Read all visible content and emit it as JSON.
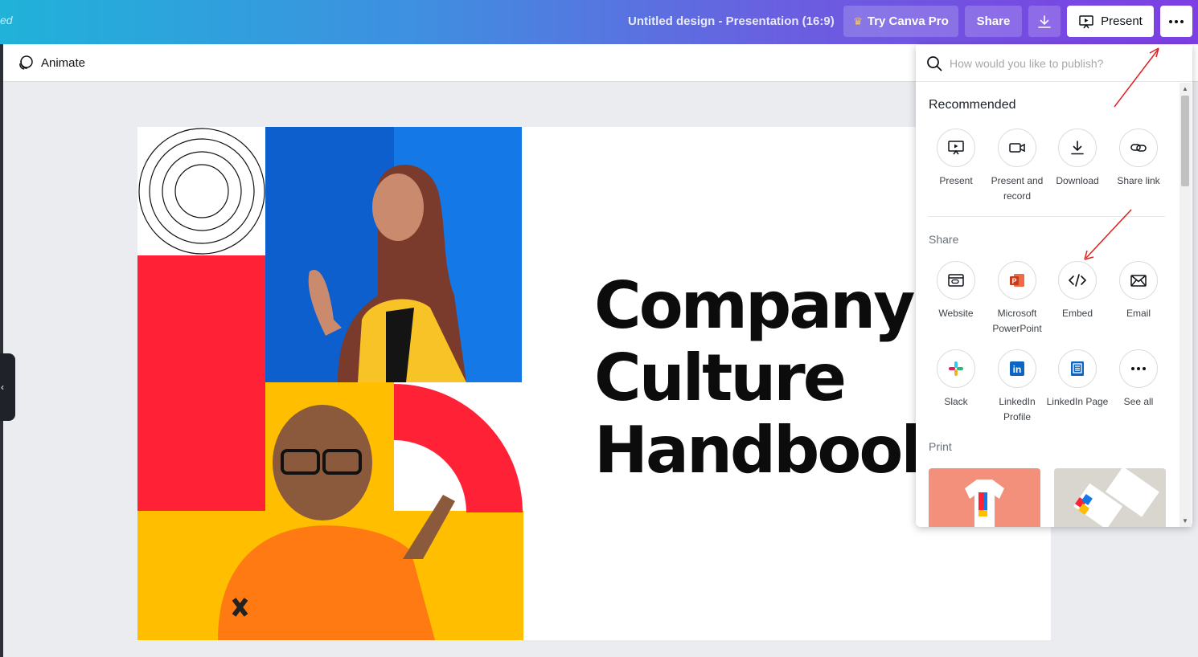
{
  "topbar": {
    "saved_fragment": "ed",
    "doc_title": "Untitled design - Presentation (16:9)",
    "try_pro_label": "Try Canva Pro",
    "share_label": "Share",
    "present_label": "Present",
    "download_icon": "download-icon",
    "more_icon": "more-horizontal-icon"
  },
  "toolbar": {
    "animate_label": "Animate"
  },
  "slide": {
    "title_lines": [
      "Company",
      "Culture",
      "Handbook"
    ]
  },
  "publish_panel": {
    "search_placeholder": "How would you like to publish?",
    "recommended_title": "Recommended",
    "recommended": [
      {
        "label": "Present",
        "icon": "present-icon"
      },
      {
        "label": "Present and record",
        "icon": "record-video-icon"
      },
      {
        "label": "Download",
        "icon": "download-icon"
      },
      {
        "label": "Share link",
        "icon": "link-icon"
      }
    ],
    "share_title": "Share",
    "share": [
      {
        "label": "Website",
        "icon": "website-icon"
      },
      {
        "label": "Microsoft PowerPoint",
        "icon": "powerpoint-icon"
      },
      {
        "label": "Embed",
        "icon": "embed-code-icon"
      },
      {
        "label": "Email",
        "icon": "email-icon"
      },
      {
        "label": "Slack",
        "icon": "slack-icon"
      },
      {
        "label": "LinkedIn Profile",
        "icon": "linkedin-icon"
      },
      {
        "label": "LinkedIn Page",
        "icon": "linkedin-page-icon"
      },
      {
        "label": "See all",
        "icon": "more-horizontal-icon"
      }
    ],
    "print_title": "Print"
  },
  "colors": {
    "topbar_gradient_start": "#20b2d9",
    "topbar_gradient_end": "#7d3fe3",
    "annotation_arrow": "#e02020",
    "slide_red": "#ff2236",
    "slide_yellow": "#ffbe00",
    "slide_blue": "#1479e6"
  }
}
